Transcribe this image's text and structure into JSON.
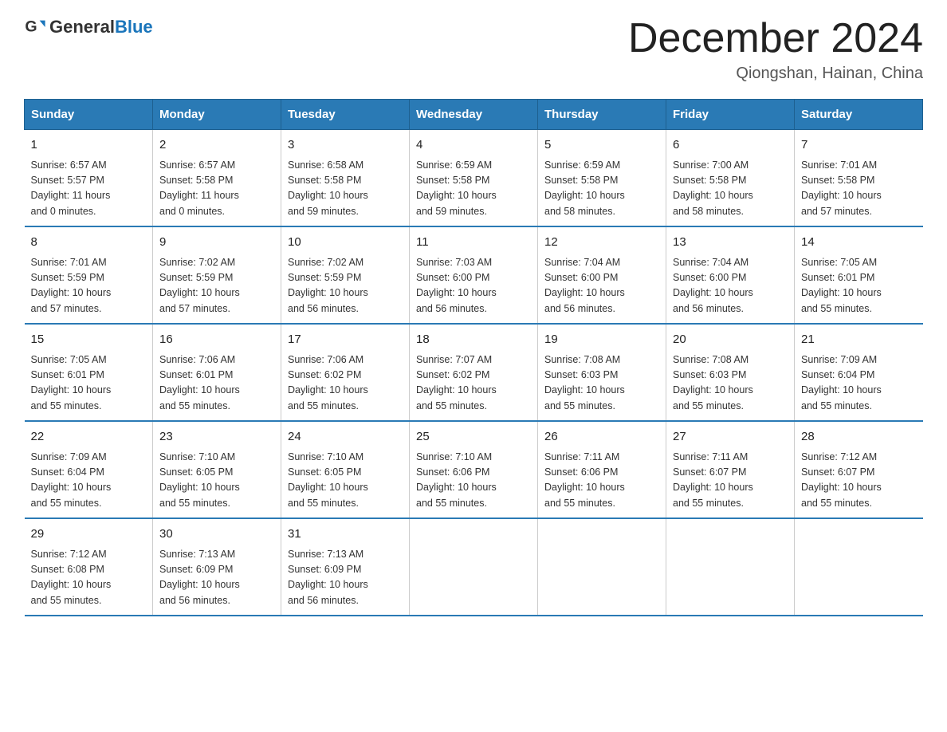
{
  "header": {
    "logo_general": "General",
    "logo_blue": "Blue",
    "month_title": "December 2024",
    "location": "Qiongshan, Hainan, China"
  },
  "days_of_week": [
    "Sunday",
    "Monday",
    "Tuesday",
    "Wednesday",
    "Thursday",
    "Friday",
    "Saturday"
  ],
  "weeks": [
    [
      {
        "day": "1",
        "info": "Sunrise: 6:57 AM\nSunset: 5:57 PM\nDaylight: 11 hours\nand 0 minutes."
      },
      {
        "day": "2",
        "info": "Sunrise: 6:57 AM\nSunset: 5:58 PM\nDaylight: 11 hours\nand 0 minutes."
      },
      {
        "day": "3",
        "info": "Sunrise: 6:58 AM\nSunset: 5:58 PM\nDaylight: 10 hours\nand 59 minutes."
      },
      {
        "day": "4",
        "info": "Sunrise: 6:59 AM\nSunset: 5:58 PM\nDaylight: 10 hours\nand 59 minutes."
      },
      {
        "day": "5",
        "info": "Sunrise: 6:59 AM\nSunset: 5:58 PM\nDaylight: 10 hours\nand 58 minutes."
      },
      {
        "day": "6",
        "info": "Sunrise: 7:00 AM\nSunset: 5:58 PM\nDaylight: 10 hours\nand 58 minutes."
      },
      {
        "day": "7",
        "info": "Sunrise: 7:01 AM\nSunset: 5:58 PM\nDaylight: 10 hours\nand 57 minutes."
      }
    ],
    [
      {
        "day": "8",
        "info": "Sunrise: 7:01 AM\nSunset: 5:59 PM\nDaylight: 10 hours\nand 57 minutes."
      },
      {
        "day": "9",
        "info": "Sunrise: 7:02 AM\nSunset: 5:59 PM\nDaylight: 10 hours\nand 57 minutes."
      },
      {
        "day": "10",
        "info": "Sunrise: 7:02 AM\nSunset: 5:59 PM\nDaylight: 10 hours\nand 56 minutes."
      },
      {
        "day": "11",
        "info": "Sunrise: 7:03 AM\nSunset: 6:00 PM\nDaylight: 10 hours\nand 56 minutes."
      },
      {
        "day": "12",
        "info": "Sunrise: 7:04 AM\nSunset: 6:00 PM\nDaylight: 10 hours\nand 56 minutes."
      },
      {
        "day": "13",
        "info": "Sunrise: 7:04 AM\nSunset: 6:00 PM\nDaylight: 10 hours\nand 56 minutes."
      },
      {
        "day": "14",
        "info": "Sunrise: 7:05 AM\nSunset: 6:01 PM\nDaylight: 10 hours\nand 55 minutes."
      }
    ],
    [
      {
        "day": "15",
        "info": "Sunrise: 7:05 AM\nSunset: 6:01 PM\nDaylight: 10 hours\nand 55 minutes."
      },
      {
        "day": "16",
        "info": "Sunrise: 7:06 AM\nSunset: 6:01 PM\nDaylight: 10 hours\nand 55 minutes."
      },
      {
        "day": "17",
        "info": "Sunrise: 7:06 AM\nSunset: 6:02 PM\nDaylight: 10 hours\nand 55 minutes."
      },
      {
        "day": "18",
        "info": "Sunrise: 7:07 AM\nSunset: 6:02 PM\nDaylight: 10 hours\nand 55 minutes."
      },
      {
        "day": "19",
        "info": "Sunrise: 7:08 AM\nSunset: 6:03 PM\nDaylight: 10 hours\nand 55 minutes."
      },
      {
        "day": "20",
        "info": "Sunrise: 7:08 AM\nSunset: 6:03 PM\nDaylight: 10 hours\nand 55 minutes."
      },
      {
        "day": "21",
        "info": "Sunrise: 7:09 AM\nSunset: 6:04 PM\nDaylight: 10 hours\nand 55 minutes."
      }
    ],
    [
      {
        "day": "22",
        "info": "Sunrise: 7:09 AM\nSunset: 6:04 PM\nDaylight: 10 hours\nand 55 minutes."
      },
      {
        "day": "23",
        "info": "Sunrise: 7:10 AM\nSunset: 6:05 PM\nDaylight: 10 hours\nand 55 minutes."
      },
      {
        "day": "24",
        "info": "Sunrise: 7:10 AM\nSunset: 6:05 PM\nDaylight: 10 hours\nand 55 minutes."
      },
      {
        "day": "25",
        "info": "Sunrise: 7:10 AM\nSunset: 6:06 PM\nDaylight: 10 hours\nand 55 minutes."
      },
      {
        "day": "26",
        "info": "Sunrise: 7:11 AM\nSunset: 6:06 PM\nDaylight: 10 hours\nand 55 minutes."
      },
      {
        "day": "27",
        "info": "Sunrise: 7:11 AM\nSunset: 6:07 PM\nDaylight: 10 hours\nand 55 minutes."
      },
      {
        "day": "28",
        "info": "Sunrise: 7:12 AM\nSunset: 6:07 PM\nDaylight: 10 hours\nand 55 minutes."
      }
    ],
    [
      {
        "day": "29",
        "info": "Sunrise: 7:12 AM\nSunset: 6:08 PM\nDaylight: 10 hours\nand 55 minutes."
      },
      {
        "day": "30",
        "info": "Sunrise: 7:13 AM\nSunset: 6:09 PM\nDaylight: 10 hours\nand 56 minutes."
      },
      {
        "day": "31",
        "info": "Sunrise: 7:13 AM\nSunset: 6:09 PM\nDaylight: 10 hours\nand 56 minutes."
      },
      {
        "day": "",
        "info": ""
      },
      {
        "day": "",
        "info": ""
      },
      {
        "day": "",
        "info": ""
      },
      {
        "day": "",
        "info": ""
      }
    ]
  ]
}
